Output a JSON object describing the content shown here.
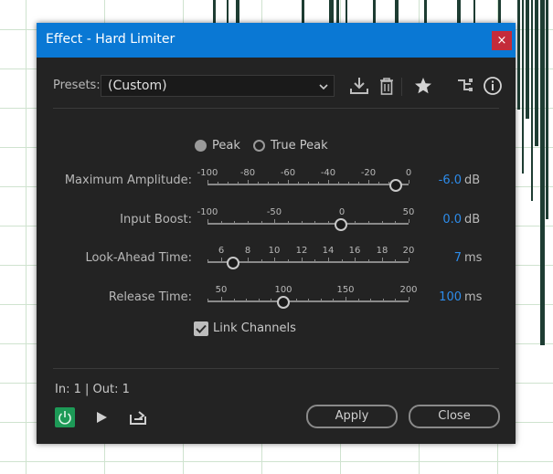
{
  "dialog": {
    "title": "Effect - Hard Limiter",
    "close_glyph": "×"
  },
  "presets": {
    "label": "Presets:",
    "value": "(Custom)",
    "icons": [
      "save-preset-icon",
      "delete-preset-icon",
      "favorite-star-icon",
      "routing-icon",
      "info-icon"
    ]
  },
  "mode": {
    "options": [
      "Peak",
      "True Peak"
    ],
    "selected": "Peak"
  },
  "sliders": {
    "max_amp": {
      "label": "Maximum Amplitude:",
      "ticks": [
        "-100",
        "-80",
        "-60",
        "-40",
        "-20",
        "0"
      ],
      "value": "-6.0",
      "unit": "dB"
    },
    "input_boost": {
      "label": "Input Boost:",
      "ticks": [
        "-100",
        "-50",
        "0",
        "50"
      ],
      "value": "0.0",
      "unit": "dB"
    },
    "look_ahead": {
      "label": "Look-Ahead Time:",
      "ticks": [
        "6",
        "8",
        "10",
        "12",
        "14",
        "16",
        "18",
        "20"
      ],
      "value": "7",
      "unit": "ms"
    },
    "release": {
      "label": "Release Time:",
      "ticks": [
        "50",
        "100",
        "150",
        "200"
      ],
      "value": "100",
      "unit": "ms"
    }
  },
  "link_channels": {
    "label": "Link Channels",
    "checked": true
  },
  "footer": {
    "io": "In: 1 | Out: 1",
    "apply": "Apply",
    "close": "Close"
  },
  "colors": {
    "title_bar": "#0a78d4",
    "value_text": "#2d8ceb",
    "power_on": "#1d9a57",
    "close_button": "#c42b3a"
  }
}
